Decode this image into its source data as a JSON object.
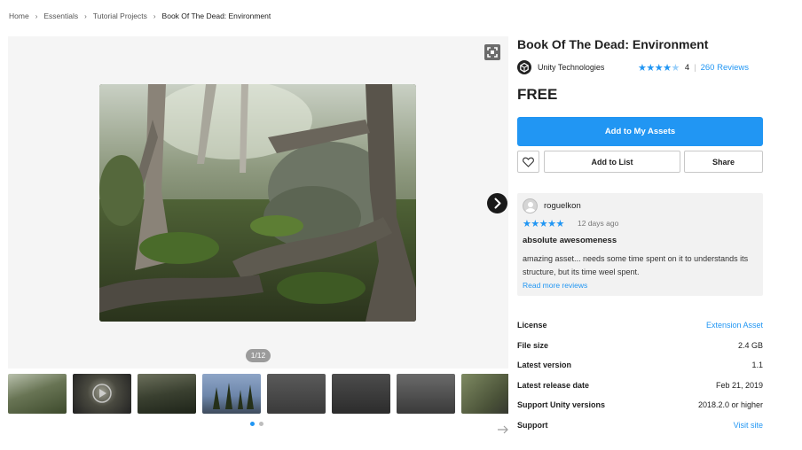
{
  "breadcrumb": [
    "Home",
    "Essentials",
    "Tutorial Projects",
    "Book Of The Dead: Environment"
  ],
  "gallery": {
    "counter": "1/12",
    "thumbnail_count": 8,
    "page_dots": 2,
    "active_dot": 0
  },
  "product": {
    "title": "Book Of The Dead: Environment",
    "publisher": "Unity Technologies",
    "rating": 4,
    "rating_label": "4",
    "reviews_link": "260 Reviews",
    "price": "FREE"
  },
  "actions": {
    "add_to_assets": "Add to My Assets",
    "add_to_list": "Add to List",
    "share": "Share"
  },
  "review": {
    "reviewer": "roguelkon",
    "stars": 5,
    "date": "12 days ago",
    "title": "absolute awesomeness",
    "body": "amazing asset... needs some time spent on it to understands its structure, but its time weel spent.",
    "read_more": "Read more reviews"
  },
  "details": [
    {
      "label": "License",
      "value": "Extension Asset",
      "link": true
    },
    {
      "label": "File size",
      "value": "2.4 GB",
      "link": false
    },
    {
      "label": "Latest version",
      "value": "1.1",
      "link": false
    },
    {
      "label": "Latest release date",
      "value": "Feb 21, 2019",
      "link": false
    },
    {
      "label": "Support Unity versions",
      "value": "2018.2.0 or higher",
      "link": false
    },
    {
      "label": "Support",
      "value": "Visit site",
      "link": true
    }
  ],
  "colors": {
    "accent": "#2196f3",
    "panel_bg": "#f5f5f5",
    "review_bg": "#f2f2f2"
  }
}
